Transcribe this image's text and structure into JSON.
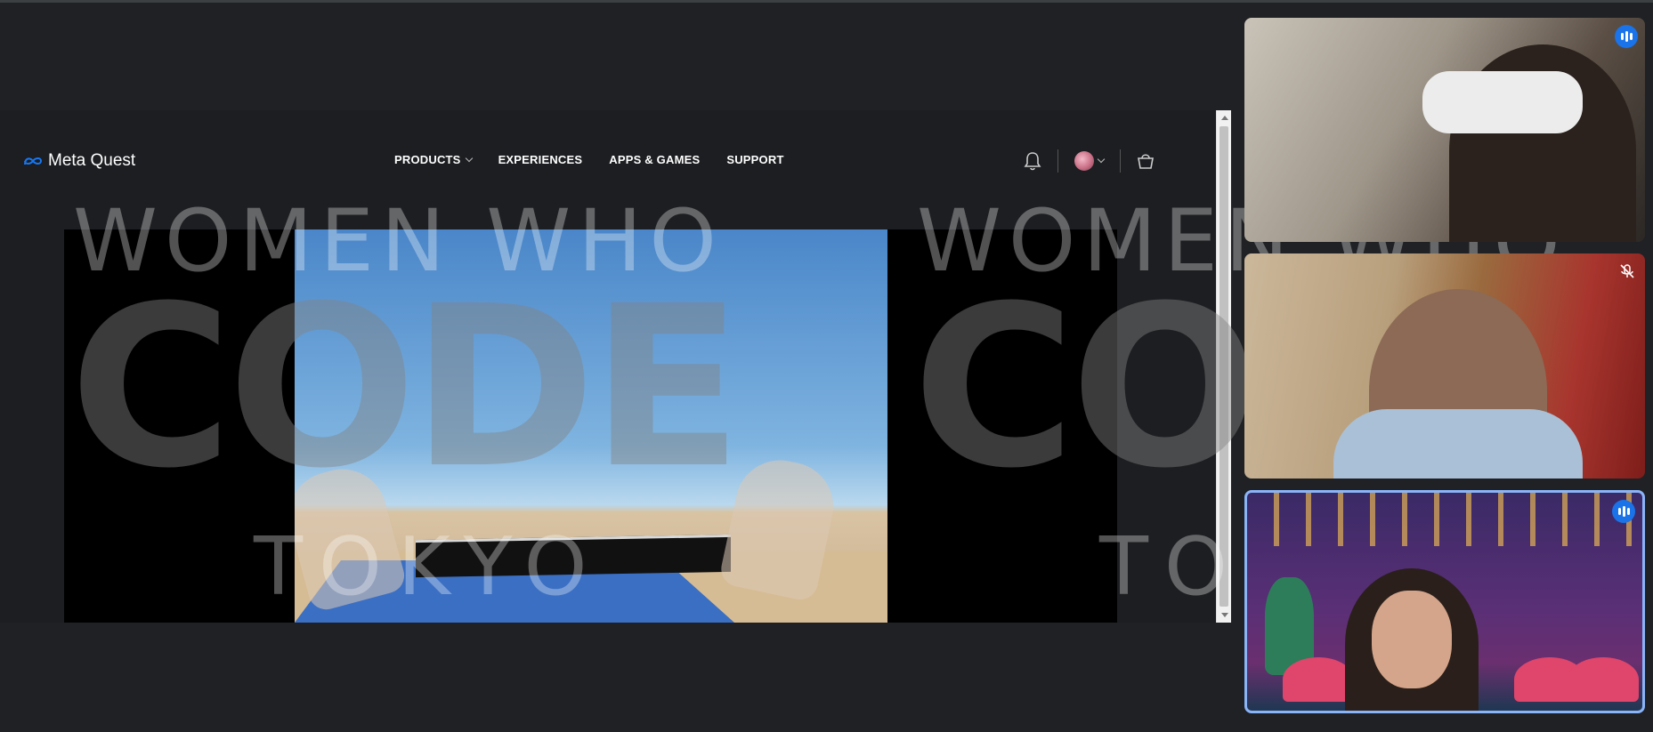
{
  "site": {
    "brand": "Meta Quest",
    "nav": [
      {
        "label": "PRODUCTS",
        "has_dropdown": true
      },
      {
        "label": "EXPERIENCES"
      },
      {
        "label": "APPS & GAMES"
      },
      {
        "label": "SUPPORT"
      }
    ],
    "icons": [
      "bell-icon",
      "avatar",
      "cart-icon"
    ]
  },
  "watermark": {
    "line1": "WOMEN WHO",
    "line2": "CODE",
    "line3": "TOKYO"
  },
  "participants": [
    {
      "status": "speaking",
      "status_icon": "speaking-icon",
      "accent": "#1a73e8"
    },
    {
      "status": "muted",
      "status_icon": "mic-off-icon"
    },
    {
      "status": "speaking",
      "status_icon": "speaking-icon",
      "highlighted": true,
      "accent": "#8ab4f8"
    }
  ],
  "colors": {
    "background": "#202124",
    "active_speaker_border": "#8ab4f8",
    "badge": "#1a73e8"
  }
}
